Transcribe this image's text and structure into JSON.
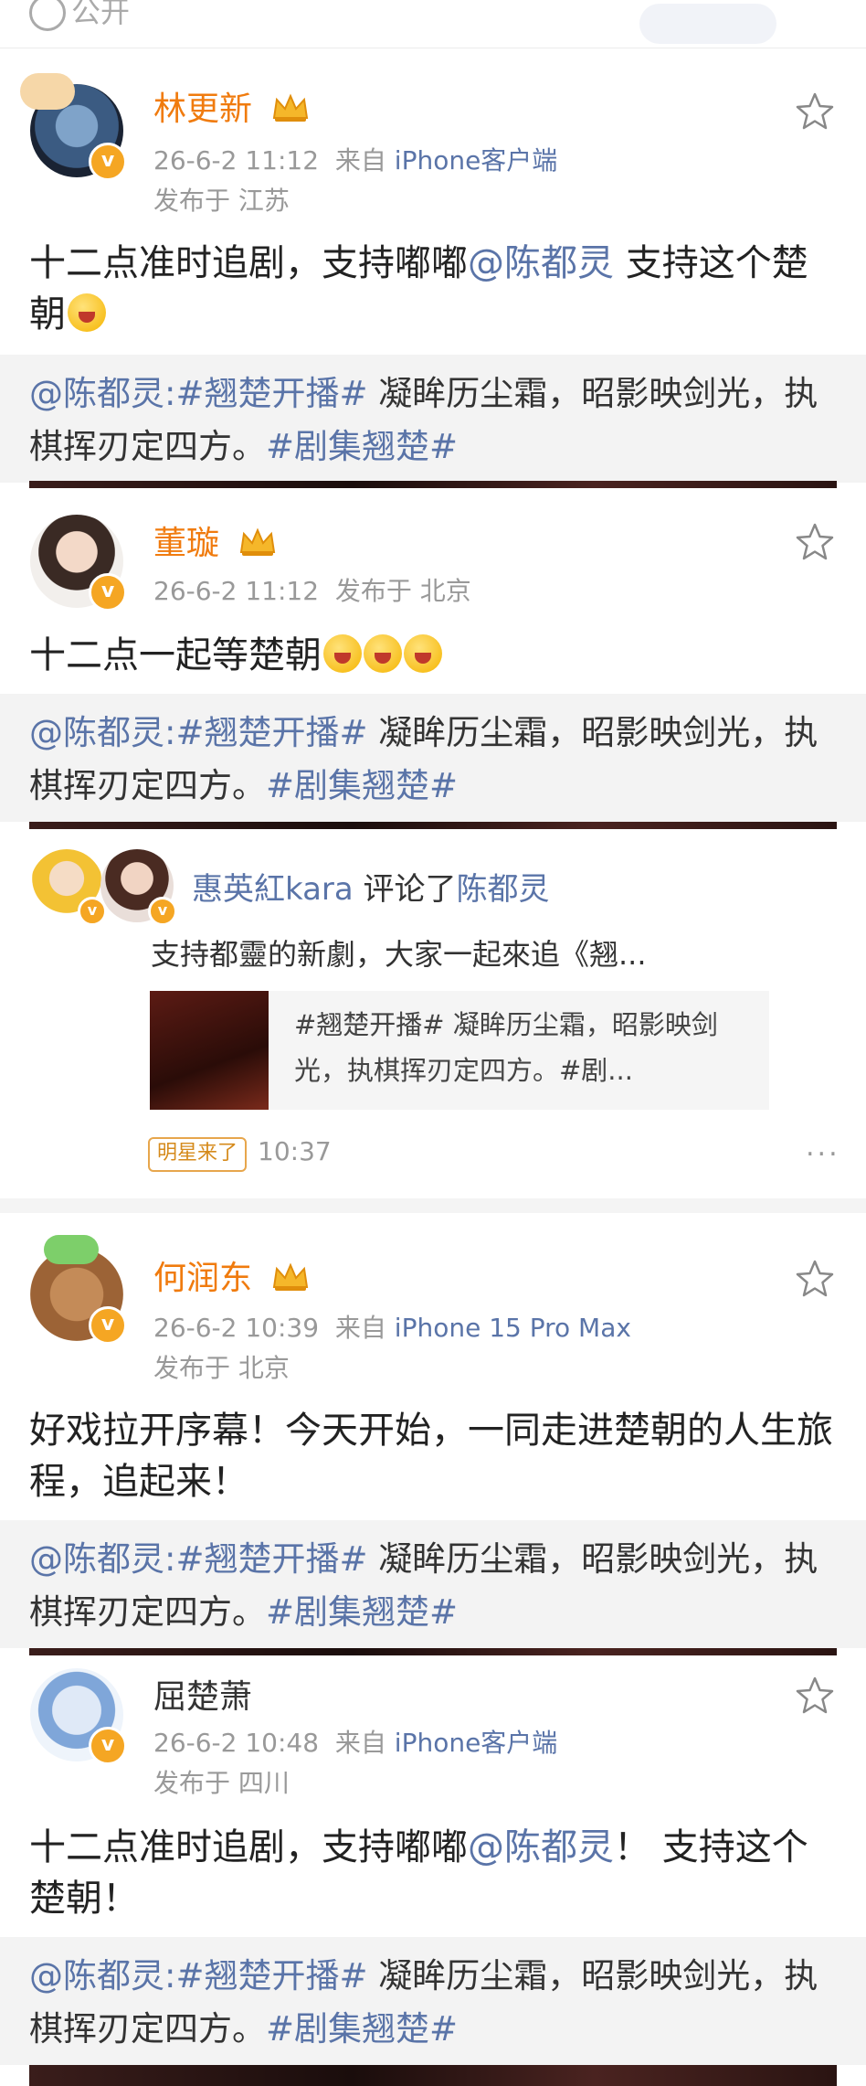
{
  "top_strip": {
    "label": "公开"
  },
  "posts": [
    {
      "name": "林更新",
      "time": "26-6-2 11:12",
      "source_prefix": "来自",
      "source": "iPhone客户端",
      "location": "发布于 江苏",
      "content_a": "十二点准时追剧，支持嘟嘟",
      "content_mention": "@陈都灵",
      "content_b": " 支持这个楚朝",
      "repost_mention": "@陈都灵",
      "repost_tag1": ":#翘楚开播#",
      "repost_text": " 凝眸历尘霜，昭影映剑光，执棋挥刃定四方。",
      "repost_tag2": "#剧集翘楚#"
    },
    {
      "name": "董璇",
      "time": "26-6-2 11:12",
      "location": "发布于 北京",
      "content_a": "十二点一起等楚朝",
      "repost_mention": "@陈都灵",
      "repost_tag1": ":#翘楚开播#",
      "repost_text": " 凝眸历尘霜，昭影映剑光，执棋挥刃定四方。",
      "repost_tag2": "#剧集翘楚#"
    },
    {
      "name": "何润东",
      "time": "26-6-2 10:39",
      "source_prefix": "来自",
      "source": "iPhone 15 Pro Max",
      "location": "发布于 北京",
      "content_a": "好戏拉开序幕！今天开始，一同走进楚朝的人生旅程，追起来！",
      "repost_mention": "@陈都灵",
      "repost_tag1": ":#翘楚开播#",
      "repost_text": " 凝眸历尘霜，昭影映剑光，执棋挥刃定四方。",
      "repost_tag2": "#剧集翘楚#"
    },
    {
      "name": "屈楚萧",
      "time": "26-6-2 10:48",
      "source_prefix": "来自",
      "source": "iPhone客户端",
      "location": "发布于 四川",
      "content_a": "十二点准时追剧，支持嘟嘟",
      "content_mention": "@陈都灵",
      "content_b": "！ 支持这个楚朝！",
      "repost_mention": "@陈都灵",
      "repost_tag1": ":#翘楚开播#",
      "repost_text": " 凝眸历尘霜，昭影映剑光，执棋挥刃定四方。",
      "repost_tag2": "#剧集翘楚#"
    }
  ],
  "comment_card": {
    "user": "惠英紅kara",
    "verb": " 评论了",
    "target": "陈都灵",
    "text": "支持都靈的新劇，大家一起來追《翘...",
    "quote": "#翘楚开播# 凝眸历尘霜，昭影映剑光，执棋挥刃定四方。#剧...",
    "badge": "明星来了",
    "time": "10:37",
    "more": "..."
  },
  "colors": {
    "vip_name": "#f07b0e",
    "link": "#5a74a8",
    "repost_bg": "#f3f3f3",
    "verified": "#f5a623"
  }
}
